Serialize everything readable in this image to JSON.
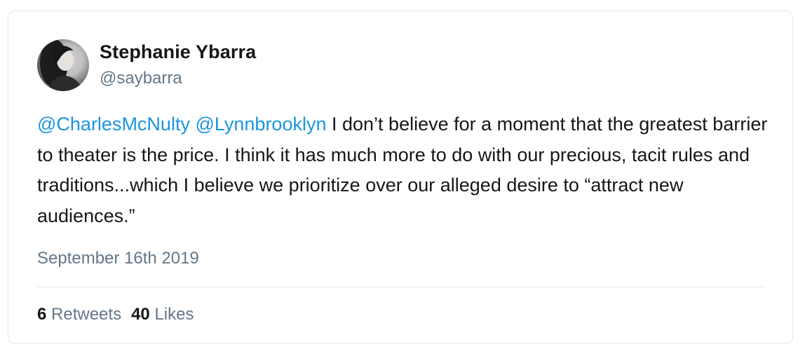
{
  "author": {
    "name": "Stephanie Ybarra",
    "handle": "@saybarra"
  },
  "tweet": {
    "mentions": [
      "@CharlesMcNulty",
      "@Lynnbrooklyn"
    ],
    "body": "I don’t believe for a moment that the greatest barrier to theater is the price. I think it has much more to do with our precious, tacit rules and traditions...which I believe we prioritize over our alleged desire to “attract new audiences.”",
    "date": "September 16th 2019"
  },
  "stats": {
    "retweets_count": "6",
    "retweets_label": "Retweets",
    "likes_count": "40",
    "likes_label": "Likes"
  },
  "colors": {
    "mention": "#1b95e0",
    "text": "#14171a",
    "muted": "#657786",
    "border": "#e1e8ed"
  }
}
